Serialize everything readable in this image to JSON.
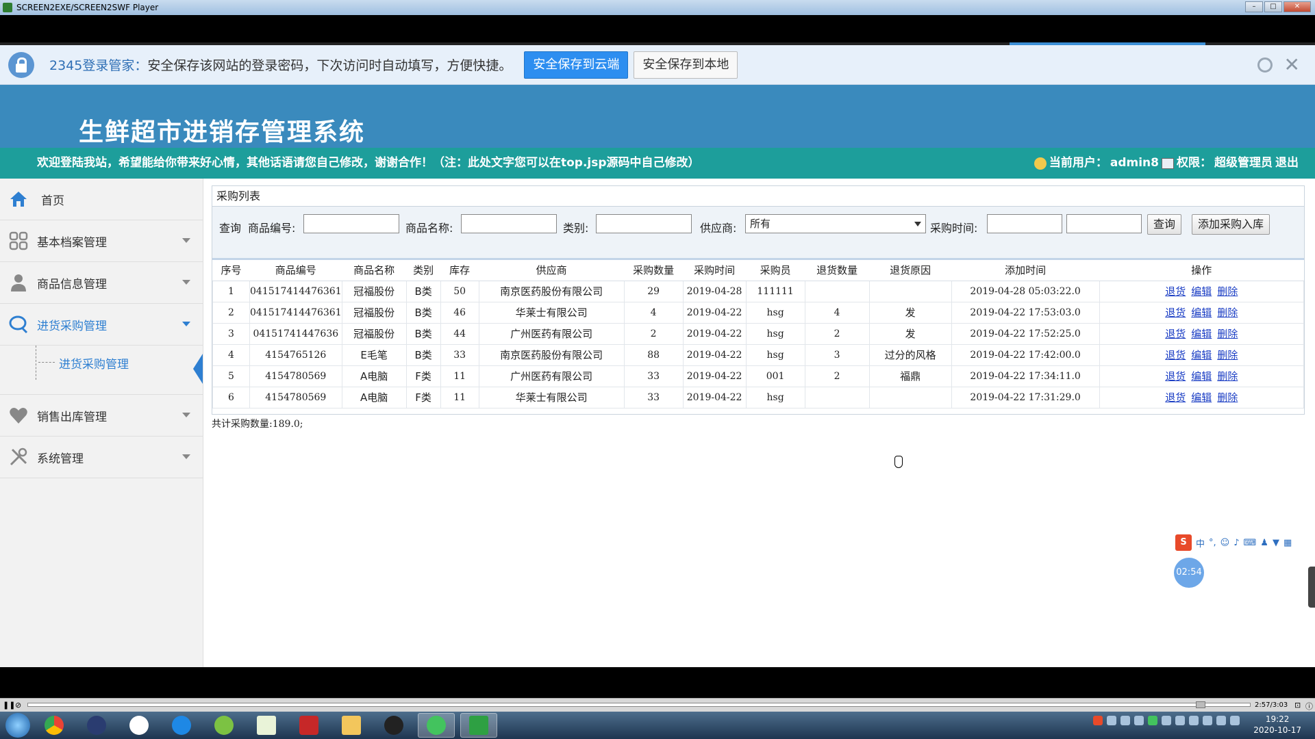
{
  "window": {
    "title": "SCREEN2EXE/SCREEN2SWF Player"
  },
  "pwbar": {
    "brand": "2345登录管家：",
    "message": "安全保存该网站的登录密码，下次访问时自动填写，方便快捷。",
    "btn_cloud": "安全保存到云端",
    "btn_local": "安全保存到本地"
  },
  "header": {
    "title": "生鲜超市进销存管理系统",
    "welcome": "欢迎登陆我站，希望能给你带来好心情，其他话语请您自己修改，谢谢合作！（注：此处文字您可以在top.jsp源码中自己修改）",
    "current_user_label": "当前用户：",
    "current_user": "admin8",
    "role_label": "权限：",
    "role": "超级管理员",
    "logout": "退出"
  },
  "sidebar": {
    "home": "首页",
    "items": [
      {
        "label": "基本档案管理"
      },
      {
        "label": "商品信息管理"
      },
      {
        "label": "进货采购管理"
      },
      {
        "label": "销售出库管理"
      },
      {
        "label": "系统管理"
      }
    ],
    "sub_item": "进货采购管理"
  },
  "panel": {
    "title": "采购列表",
    "search": {
      "query_label": "查询",
      "code_label": "商品编号:",
      "name_label": "商品名称:",
      "category_label": "类别:",
      "supplier_label": "供应商:",
      "supplier_value": "所有",
      "time_label": "采购时间:",
      "search_btn": "查询",
      "add_btn": "添加采购入库"
    },
    "columns": [
      "序号",
      "商品编号",
      "商品名称",
      "类别",
      "库存",
      "供应商",
      "采购数量",
      "采购时间",
      "采购员",
      "退货数量",
      "退货原因",
      "添加时间",
      "操作"
    ],
    "rows": [
      [
        "1",
        "041517414476361",
        "冠福股份",
        "B类",
        "50",
        "南京医药股份有限公司",
        "29",
        "2019-04-28",
        "111111",
        "",
        "",
        "2019-04-28 05:03:22.0"
      ],
      [
        "2",
        "041517414476361",
        "冠福股份",
        "B类",
        "46",
        "华莱士有限公司",
        "4",
        "2019-04-22",
        "hsg",
        "4",
        "发",
        "2019-04-22 17:53:03.0"
      ],
      [
        "3",
        "04151741447636",
        "冠福股份",
        "B类",
        "44",
        "广州医药有限公司",
        "2",
        "2019-04-22",
        "hsg",
        "2",
        "发",
        "2019-04-22 17:52:25.0"
      ],
      [
        "4",
        "4154765126",
        "E毛笔",
        "B类",
        "33",
        "南京医药股份有限公司",
        "88",
        "2019-04-22",
        "hsg",
        "3",
        "过分的风格",
        "2019-04-22 17:42:00.0"
      ],
      [
        "5",
        "4154780569",
        "A电脑",
        "F类",
        "11",
        "广州医药有限公司",
        "33",
        "2019-04-22",
        "001",
        "2",
        "福鼎",
        "2019-04-22 17:34:11.0"
      ],
      [
        "6",
        "4154780569",
        "A电脑",
        "F类",
        "11",
        "华莱士有限公司",
        "33",
        "2019-04-22",
        "hsg",
        "",
        "",
        "2019-04-22 17:31:29.0"
      ]
    ],
    "ops": [
      "退货",
      "编辑",
      "删除"
    ],
    "total": "共计采购数量:189.0;"
  },
  "overlay": {
    "timer": "02:54",
    "ime_lang": "中"
  },
  "player": {
    "time": "2:57/3:03"
  },
  "taskbar": {
    "time": "19:22",
    "date": "2020-10-17"
  }
}
